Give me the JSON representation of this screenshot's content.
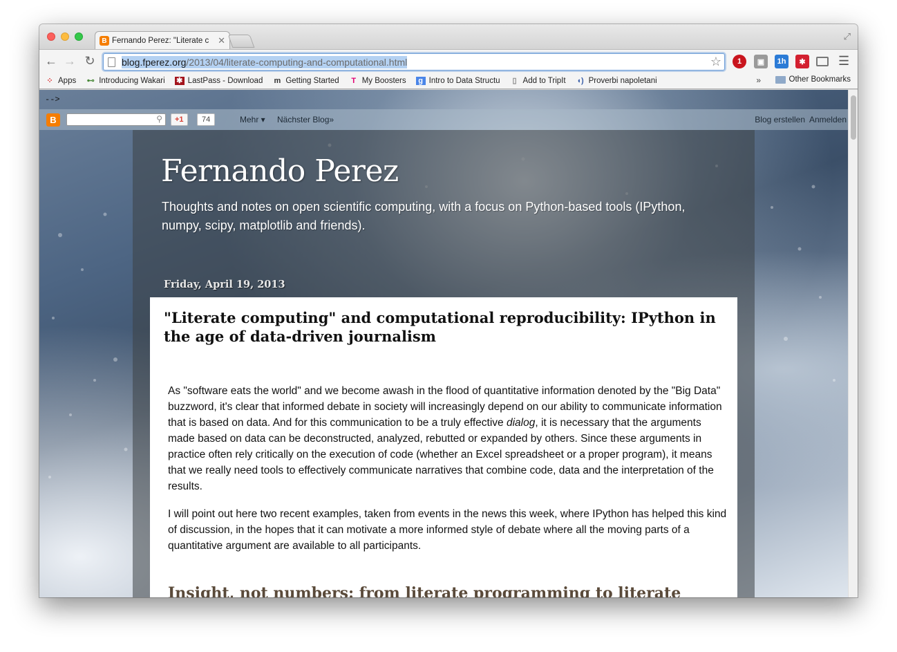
{
  "browser": {
    "tab_title": "Fernando Perez: \"Literate c",
    "url_domain": "blog.fperez.org",
    "url_path": "/2013/04/literate-computing-and-computational.html",
    "extensions": {
      "ext1_badge": "1",
      "ext3_badge": "1h"
    }
  },
  "bookmarks": {
    "items": [
      {
        "label": "Apps",
        "icon": "apps-grid-icon"
      },
      {
        "label": "Introducing Wakari",
        "icon": "wakari-icon"
      },
      {
        "label": "LastPass - Download",
        "icon": "lastpass-icon"
      },
      {
        "label": "Getting Started",
        "icon": "m-icon"
      },
      {
        "label": "My Boosters",
        "icon": "t-icon"
      },
      {
        "label": "Intro to Data Structu",
        "icon": "google-icon"
      },
      {
        "label": "Add to TripIt",
        "icon": "page-icon"
      },
      {
        "label": "Proverbi napoletani",
        "icon": "sound-icon"
      }
    ],
    "more": "»",
    "other": "Other Bookmarks"
  },
  "page": {
    "stray_comment": "-->",
    "navbar": {
      "gplus": "+1",
      "gplus_count": "74",
      "mehr": "Mehr ▾",
      "next_blog": "Nächster Blog»",
      "create_blog": "Blog erstellen",
      "login": "Anmelden"
    },
    "blog_title": "Fernando Perez",
    "blog_description": "Thoughts and notes on open scientific computing, with a focus on Python-based tools (IPython, numpy, scipy, matplotlib and friends).",
    "date_header": "Friday, April 19, 2013",
    "post": {
      "title": "\"Literate computing\" and computational reproducibility: IPython in the age of data-driven journalism",
      "p1_a": "As \"software eats the world\" and we become awash in the flood of quantitative information denoted by the \"Big Data\" buzzword, it's clear that informed debate in society will increasingly depend on our ability to communicate information that is based on data. And for this communication to be a truly effective ",
      "p1_em": "dialog",
      "p1_b": ", it is necessary that the arguments made based on data can be deconstructed, analyzed, rebutted or expanded by others. Since these arguments in practice often rely critically on the execution of code (whether an Excel spreadsheet or a proper program), it means that we really need tools to effectively communicate narratives that combine code, data and the interpretation of the results.",
      "p2": "I will point out here two recent examples, taken from events in the news this week, where IPython has helped this kind of discussion, in the hopes that it can motivate a more informed style of debate where all the moving parts of a quantitative argument are available to all participants.",
      "section_heading": "Insight, not numbers: from literate programming to literate"
    }
  }
}
